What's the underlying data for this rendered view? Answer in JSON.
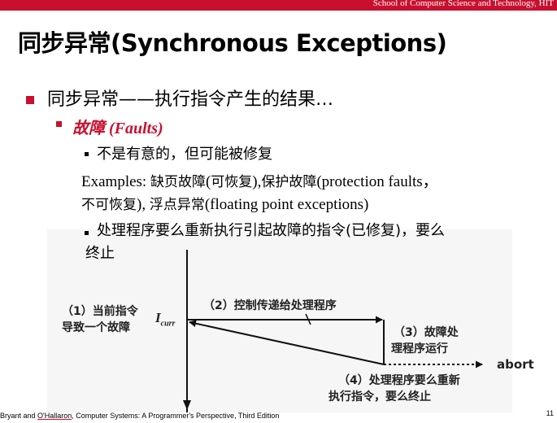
{
  "header": {
    "institution": "School of Computer Science and Technology, HIT",
    "accent_color": "#c8102e"
  },
  "slide": {
    "title": "同步异常(Synchronous Exceptions)",
    "level1": "同步异常——执行指令产生的结果…",
    "level2": "故障 (Faults)",
    "item1": "不是有意的，但可能被修复",
    "examples_prefix": "Examples: ",
    "examples_line1_a": "缺页故障",
    "examples_line1_b": "(",
    "examples_line1_c": "可恢复",
    "examples_line1_d": "),",
    "examples_line1_e": "保护故障",
    "examples_line1_f": "(protection faults，",
    "examples_line2_a": "不可恢复",
    "examples_line2_b": "), ",
    "examples_line2_c": "浮点异常",
    "examples_line2_d": "(floating point exceptions)",
    "item2_line1": "处理程序要么重新执行引起故障的指令(已修复)，要么",
    "item2_line2": "终止"
  },
  "diagram": {
    "label_1_line1": "（1）当前指令",
    "label_1_line2": "导致一个故障",
    "label_icurr": "I",
    "label_icurr_sub": "curr",
    "label_2": "（2）控制传递给处理程序",
    "label_3_line1": "（3）故障处",
    "label_3_line2": "理程序运行",
    "label_abort": "abort",
    "label_4_line1": "（4）处理程序要么重新",
    "label_4_line2": "执行指令，要么终止"
  },
  "footer": {
    "citation_prefix": "Bryant and ",
    "citation_author2": "O'Hallaron",
    "citation_rest": ", Computer Systems: A Programmer's Perspective, Third Edition",
    "page_number": "11"
  }
}
